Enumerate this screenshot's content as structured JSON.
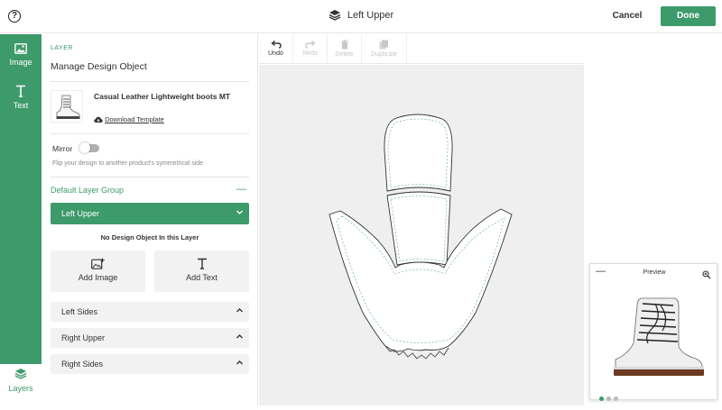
{
  "header": {
    "title": "Left Upper",
    "cancel_label": "Cancel",
    "done_label": "Done"
  },
  "rail": {
    "items": [
      {
        "label": "Image",
        "icon": "image-icon"
      },
      {
        "label": "Text",
        "icon": "text-icon"
      }
    ],
    "layers_label": "Layers"
  },
  "panel": {
    "section_label": "LAYER",
    "section_title": "Manage Design Object",
    "product": {
      "name": "Casual Leather Lightweight boots MT",
      "download_label": "Download Template"
    },
    "mirror": {
      "label": "Mirror",
      "description": "Flip your design to another product's symmetrical side"
    },
    "group_title": "Default Layer Group",
    "selected_layer": "Left Upper",
    "empty_message": "No Design Object In this Layer",
    "add_image_label": "Add Image",
    "add_text_label": "Add Text",
    "accordions": [
      "Left Sides",
      "Right Upper",
      "Right Sides"
    ]
  },
  "toolbar": {
    "undo": "Undo",
    "redo": "Redo",
    "delete": "Delete",
    "duplicate": "Duplicate"
  },
  "preview": {
    "title": "Preview"
  },
  "colors": {
    "accent": "#3d9a6a",
    "canvas_bg": "#efefef"
  }
}
